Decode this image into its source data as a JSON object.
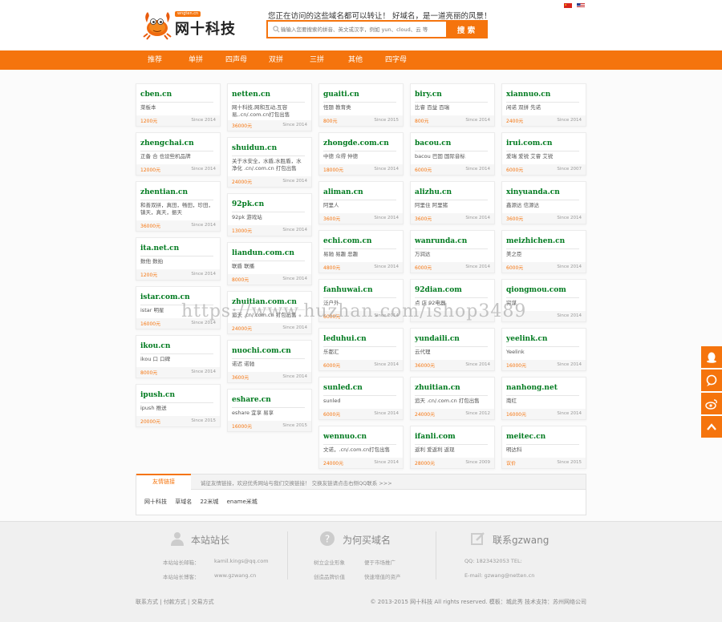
{
  "header": {
    "logo_tag": "wngten.cn",
    "logo_text": "网十科技",
    "slogan": "您正在访问的这些域名都可以转让！ 好域名，是一道亮丽的风景！",
    "search_placeholder": "输输入您要搜索的拼音、英文或汉字，例如 yun、cloud、云 等",
    "search_button": "搜 索",
    "accent": "#f5740d"
  },
  "nav": [
    "推荐",
    "单拼",
    "四声母",
    "双拼",
    "三拼",
    "其他",
    "四字母"
  ],
  "columns": [
    [
      {
        "name": "cben.cn",
        "desc": "菜板本",
        "price": "1200元",
        "since": "Since 2014"
      },
      {
        "name": "zhengchai.cn",
        "desc": "正备 合 也设些机品牌",
        "price": "12000元",
        "since": "Since 2014"
      },
      {
        "name": "zhentian.cn",
        "desc": "和善双拼，真田，畅田，珍田，镇天，真天，振天",
        "price": "36000元",
        "since": "Since 2014"
      },
      {
        "name": "ita.net.cn",
        "desc": "数他 数拍",
        "price": "1200元",
        "since": "Since 2014"
      },
      {
        "name": "istar.com.cn",
        "desc": "istar 明星",
        "price": "16000元",
        "since": "Since 2014"
      },
      {
        "name": "ikou.cn",
        "desc": "ikou 口 口碑",
        "price": "8000元",
        "since": "Since 2014"
      },
      {
        "name": "ipush.cn",
        "desc": "ipush 推送",
        "price": "20000元",
        "since": "Since 2015"
      }
    ],
    [
      {
        "name": "netten.cn",
        "desc": "网十科技,网和互动,互容易,.cn/.com.cn打包出售",
        "price": "36000元",
        "since": "Since 2014"
      },
      {
        "name": "shuidun.cn",
        "desc": "关于水安全，水盾,水胜盾，水净化 .cn/.com.cn 打包出售",
        "price": "24000元",
        "since": "Since 2014"
      },
      {
        "name": "92pk.cn",
        "desc": "92pk 游戏站",
        "price": "13000元",
        "since": "Since 2014"
      },
      {
        "name": "liandun.com.cn",
        "desc": "联盾 联播",
        "price": "8000元",
        "since": "Since 2014"
      },
      {
        "name": "zhuitian.com.cn",
        "desc": "追天 .cn/.com.cn 打包出售",
        "price": "24000元",
        "since": "Since 2014"
      },
      {
        "name": "nuochi.com.cn",
        "desc": "诺迟 诺驰",
        "price": "3600元",
        "since": "Since 2014"
      },
      {
        "name": "eshare.cn",
        "desc": "eshare 宜享 易享",
        "price": "16000元",
        "since": "Since 2015"
      }
    ],
    [
      {
        "name": "guaiti.cn",
        "desc": "怪题 教育类",
        "price": "800元",
        "since": "Since 2015"
      },
      {
        "name": "zhongde.com.cn",
        "desc": "中德 众得 仲德",
        "price": "18000元",
        "since": "Since 2014"
      },
      {
        "name": "aliman.cn",
        "desc": "阿里人",
        "price": "3600元",
        "since": "Since 2014"
      },
      {
        "name": "echi.com.cn",
        "desc": "易驰 易趣 恶趣",
        "price": "4800元",
        "since": "Since 2014"
      },
      {
        "name": "fanhuwai.cn",
        "desc": "泛户外",
        "price": "6000元",
        "since": "Since 2014"
      },
      {
        "name": "leduhui.cn",
        "desc": "乐都汇",
        "price": "6000元",
        "since": "Since 2014"
      },
      {
        "name": "sunled.cn",
        "desc": "sunled",
        "price": "6000元",
        "since": "Since 2014"
      },
      {
        "name": "wennuo.cn",
        "desc": "文诺，.cn/.com.cn打包出售",
        "price": "24000元",
        "since": "Since 2014"
      }
    ],
    [
      {
        "name": "biry.cn",
        "desc": "比睿 百益 百瑞",
        "price": "800元",
        "since": "Since 2014"
      },
      {
        "name": "bacou.cn",
        "desc": "bacou 巴固 国际音标",
        "price": "6000元",
        "since": "Since 2014"
      },
      {
        "name": "alizhu.cn",
        "desc": "阿里住 阿里猪",
        "price": "3600元",
        "since": "Since 2014"
      },
      {
        "name": "wanrunda.cn",
        "desc": "万润达",
        "price": "6000元",
        "since": "Since 2014"
      },
      {
        "name": "92dian.com",
        "desc": "点 店 92电器",
        "price": "",
        "since": ""
      },
      {
        "name": "yundaili.cn",
        "desc": "云代理",
        "price": "36000元",
        "since": "Since 2014"
      },
      {
        "name": "zhuitian.cn",
        "desc": "追天 .cn/.com.cn 打包出售",
        "price": "24000元",
        "since": "Since 2012"
      },
      {
        "name": "ifanli.com",
        "desc": "返利 爱返利 返现",
        "price": "28000元",
        "since": "Since 2009"
      }
    ],
    [
      {
        "name": "xiannuo.cn",
        "desc": "闲诺 双拼 先诺",
        "price": "2400元",
        "since": "Since 2014"
      },
      {
        "name": "irui.com.cn",
        "desc": "爱瑞 爱锐 艾睿 艾锐",
        "price": "6000元",
        "since": "Since 2007"
      },
      {
        "name": "xinyuanda.cn",
        "desc": "鑫源达 信源达",
        "price": "3600元",
        "since": "Since 2014"
      },
      {
        "name": "meizhichen.cn",
        "desc": "美之臣",
        "price": "6000元",
        "since": "Since 2014"
      },
      {
        "name": "qiongmou.com",
        "desc": "穷谋",
        "price": "",
        "since": "Since 2014"
      },
      {
        "name": "yeelink.cn",
        "desc": "Yeelink",
        "price": "16000元",
        "since": "Since 2014"
      },
      {
        "name": "nanhong.net",
        "desc": "南红",
        "price": "16000元",
        "since": "Since 2014"
      },
      {
        "name": "meitec.cn",
        "desc": "明达科",
        "price": "议价",
        "since": "Since 2015"
      }
    ]
  ],
  "links": {
    "tab": "友情链接",
    "note": "诚征友情链接，欢迎优秀网站与我们交换链接！ 交换友链请点击右侧QQ联系 >>>",
    "items": [
      "网十科技",
      "草域名",
      "22米城",
      "ename米城"
    ]
  },
  "watermark": "https://www.huzhan.com/ishop3489",
  "footer": {
    "col1": {
      "title": "本站站长",
      "l1": "本站站长邮箱：",
      "v1": "kamil.kings@qq.com",
      "l2": "本站站长博客：",
      "v2": "www.gzwang.cn"
    },
    "col2": {
      "title": "为何买域名",
      "a": "树立企业形象",
      "b": "便于市场推广",
      "c": "创造品牌价值",
      "d": "快速增值的资产"
    },
    "col3": {
      "title": "联系gzwang",
      "qq": "QQ: 1823432053  TEL:",
      "email": "E-mail: gzwang@netten.cn"
    },
    "bottom_links": "联系方式 | 付款方式 | 交易方式",
    "copyright": "© 2013-2015 网十科技 All rights reserved. 模板：城此秀 技术支持：苏州网络公司"
  }
}
